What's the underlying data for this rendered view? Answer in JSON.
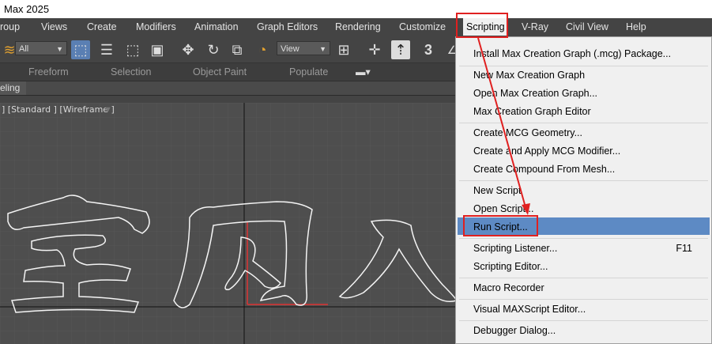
{
  "window": {
    "title": "Max 2025"
  },
  "menubar": {
    "items": [
      "roup",
      "Views",
      "Create",
      "Modifiers",
      "Animation",
      "Graph Editors",
      "Rendering",
      "Customize",
      "Scripting",
      "V-Ray",
      "Civil View",
      "Help"
    ]
  },
  "toolbar": {
    "selection_filter": "All",
    "ref_coord": "View",
    "icons": [
      "layers-icon",
      "select-object-icon",
      "select-by-name-icon",
      "rect-selection-icon",
      "window-crossing-icon",
      "move-icon",
      "rotate-icon",
      "scale-icon",
      "placement-icon",
      "mirror-icon",
      "align-icon",
      "pivot-icon",
      "snap-3-icon"
    ]
  },
  "ribbon": {
    "tabs": [
      "Freeform",
      "Selection",
      "Object Paint",
      "Populate"
    ]
  },
  "subtab": {
    "label": "eling"
  },
  "viewport": {
    "label": "] [Standard ] [Wireframe ]",
    "text_outline": "室内人"
  },
  "scripting_menu": {
    "items": [
      {
        "label": "Install Max Creation Graph (.mcg) Package..."
      },
      {
        "label": "New Max Creation Graph"
      },
      {
        "label": "Open Max Creation Graph..."
      },
      {
        "label": "Max Creation Graph Editor"
      },
      {
        "label": "Create MCG Geometry..."
      },
      {
        "label": "Create and Apply MCG Modifier..."
      },
      {
        "label": "Create Compound From Mesh..."
      },
      {
        "label": "New Script"
      },
      {
        "label": "Open Script..."
      },
      {
        "label": "Run Script..."
      },
      {
        "label": "Scripting Listener...",
        "shortcut": "F11"
      },
      {
        "label": "Scripting Editor..."
      },
      {
        "label": "Macro Recorder"
      },
      {
        "label": "Visual MAXScript Editor..."
      },
      {
        "label": "Debugger Dialog..."
      }
    ],
    "highlighted": "Run Script..."
  },
  "colors": {
    "highlight": "#5d8ac4",
    "annotation": "#e02020",
    "menu_bg": "#f0f0f0",
    "ui_bg": "#444444"
  }
}
